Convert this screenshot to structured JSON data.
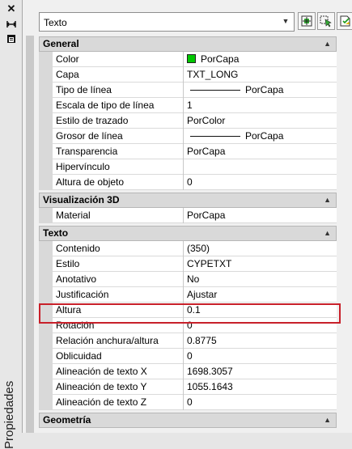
{
  "window": {
    "side_title": "Propiedades",
    "side_buttons": [
      "close-icon",
      "auto-hide-icon",
      "properties-menu-icon"
    ]
  },
  "toolbar": {
    "selected_object": "Texto",
    "buttons": [
      "toggle-pickadd-icon",
      "select-objects-icon",
      "quick-select-icon"
    ]
  },
  "categories": [
    {
      "title": "General",
      "rows": [
        {
          "name": "Color",
          "value": "PorCapa",
          "swatch": "#00c800"
        },
        {
          "name": "Capa",
          "value": "TXT_LONG"
        },
        {
          "name": "Tipo de línea",
          "value": "PorCapa",
          "linetype": true
        },
        {
          "name": "Escala de tipo de línea",
          "value": "1"
        },
        {
          "name": "Estilo de trazado",
          "value": "PorColor"
        },
        {
          "name": "Grosor de línea",
          "value": "PorCapa",
          "linetype": true
        },
        {
          "name": "Transparencia",
          "value": "PorCapa"
        },
        {
          "name": "Hipervínculo",
          "value": ""
        },
        {
          "name": "Altura de objeto",
          "value": "0"
        }
      ]
    },
    {
      "title": "Visualización 3D",
      "rows": [
        {
          "name": "Material",
          "value": "PorCapa"
        }
      ]
    },
    {
      "title": "Texto",
      "rows": [
        {
          "name": "Contenido",
          "value": "(350)"
        },
        {
          "name": "Estilo",
          "value": "CYPETXT"
        },
        {
          "name": "Anotativo",
          "value": "No"
        },
        {
          "name": "Justificación",
          "value": "Ajustar"
        },
        {
          "name": "Altura",
          "value": "0.1",
          "highlighted": true
        },
        {
          "name": "Rotación",
          "value": "0"
        },
        {
          "name": "Relación anchura/altura",
          "value": "0.8775"
        },
        {
          "name": "Oblicuidad",
          "value": "0"
        },
        {
          "name": "Alineación de texto X",
          "value": "1698.3057"
        },
        {
          "name": "Alineación de texto Y",
          "value": "1055.1643"
        },
        {
          "name": "Alineación de texto Z",
          "value": "0"
        }
      ]
    },
    {
      "title": "Geometría",
      "rows": []
    }
  ],
  "colors": {
    "highlight_border": "#c8202a",
    "category_bg": "#d9d9d9",
    "swatch_green": "#00c800"
  }
}
